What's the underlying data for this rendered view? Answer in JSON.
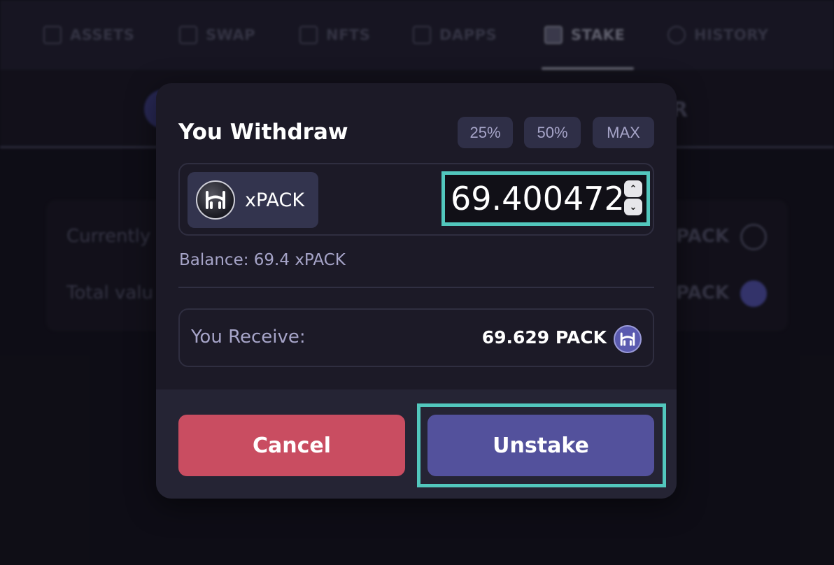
{
  "nav": {
    "items": [
      {
        "label": "ASSETS",
        "icon": "wallet-icon"
      },
      {
        "label": "SWAP",
        "icon": "swap-arrows-icon"
      },
      {
        "label": "NFTS",
        "icon": "grid-icon"
      },
      {
        "label": "DAPPS",
        "icon": "apps-icon"
      },
      {
        "label": "STAKE",
        "icon": "stack-icon",
        "active": true
      },
      {
        "label": "HISTORY",
        "icon": "clock-icon"
      }
    ]
  },
  "background": {
    "subtab_partial": "R",
    "rows": [
      {
        "label": "Currently",
        "value": "PACK"
      },
      {
        "label": "Total valu",
        "value": "PACK"
      }
    ]
  },
  "modal": {
    "title": "You Withdraw",
    "percent_buttons": [
      "25%",
      "50%",
      "MAX"
    ],
    "token": {
      "name": "xPACK",
      "icon": "xpack-token-icon"
    },
    "amount": "69.400472",
    "balance_text": "Balance: 69.4 xPACK",
    "receive": {
      "label": "You Receive:",
      "value": "69.629 PACK",
      "icon": "pack-token-icon"
    },
    "cancel_label": "Cancel",
    "unstake_label": "Unstake"
  },
  "colors": {
    "highlight": "#52c7bd",
    "cancel": "#c94d61",
    "unstake": "#53519c",
    "modal_bg": "#1c1a27"
  }
}
